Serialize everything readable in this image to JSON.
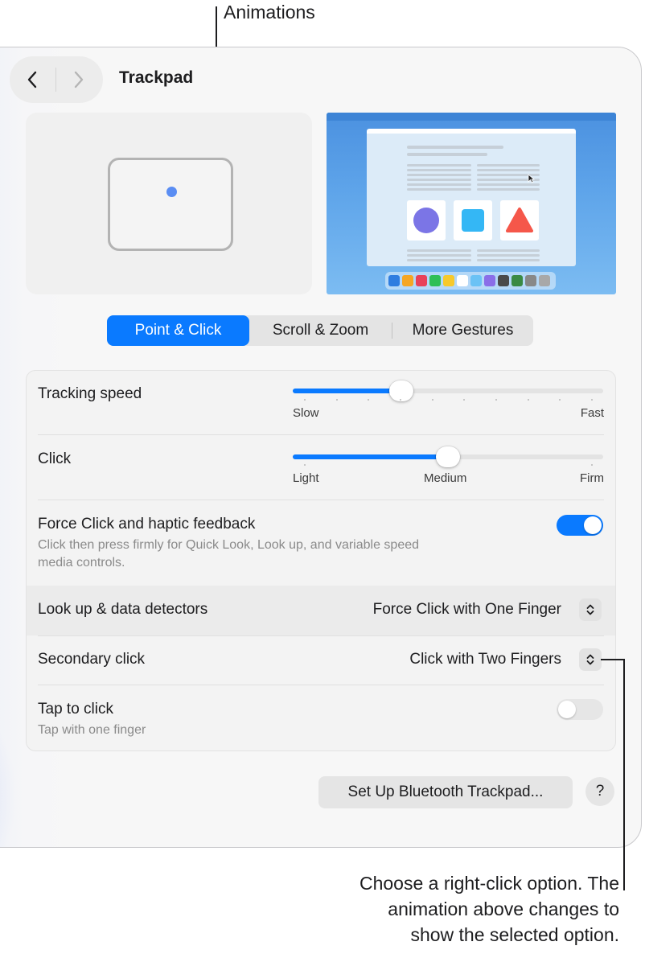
{
  "callouts": {
    "top": "Animations",
    "bottom": [
      "Choose a right-click option. The",
      "animation above changes to",
      "show the selected option."
    ]
  },
  "window": {
    "title": "Trackpad",
    "back_icon": "chevron-left-icon",
    "forward_icon": "chevron-right-icon"
  },
  "tabs": [
    {
      "label": "Point & Click",
      "active": true
    },
    {
      "label": "Scroll & Zoom",
      "active": false
    },
    {
      "label": "More Gestures",
      "active": false
    }
  ],
  "settings": {
    "tracking_speed": {
      "label": "Tracking speed",
      "min_label": "Slow",
      "max_label": "Fast",
      "value_fraction": 0.35
    },
    "click": {
      "label": "Click",
      "labels": [
        "Light",
        "Medium",
        "Firm"
      ],
      "value_fraction": 0.5
    },
    "force_click": {
      "label": "Force Click and haptic feedback",
      "description_lines": [
        "Click then press firmly for Quick Look, Look up, and variable speed",
        "media controls."
      ],
      "enabled": true
    },
    "look_up": {
      "label": "Look up & data detectors",
      "value": "Force Click with One Finger"
    },
    "secondary_click": {
      "label": "Secondary click",
      "value": "Click with Two Fingers"
    },
    "tap_to_click": {
      "label": "Tap to click",
      "description": "Tap with one finger",
      "enabled": false
    }
  },
  "buttons": {
    "setup": "Set Up Bluetooth Trackpad...",
    "help": "?"
  },
  "colors": {
    "accent": "#0a7aff",
    "toggle_off": "#e6e6e6"
  }
}
